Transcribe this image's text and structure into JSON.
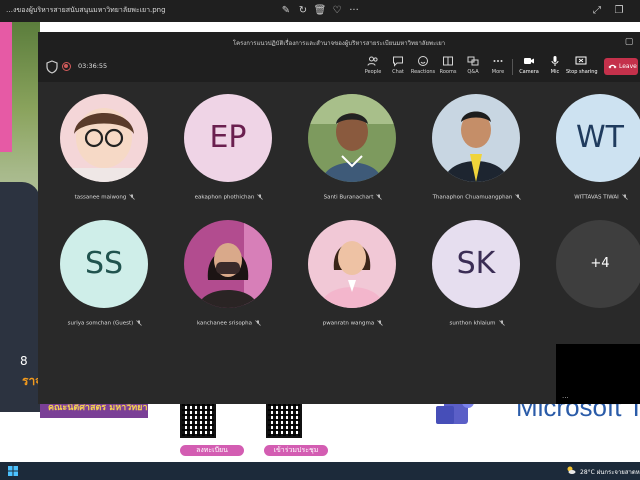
{
  "viewer": {
    "file_title": "…งของผู้บริหารสายสนับสนุนมหาวิทยาลัยพะเยา.png",
    "icons": [
      "edit-icon",
      "rotate-icon",
      "delete-icon",
      "heart-icon",
      "more-icon",
      "expand-icon",
      "window-restore-icon"
    ]
  },
  "slide": {
    "number_text": "8",
    "orange_text": "ราจารย์",
    "faculty_text": "คณะนิติศาสตร มหาวิทยาลัยพะเยา",
    "qr_left_label": "ลงทะเบียน",
    "qr_right_label": "เข้าร่วมประชุม",
    "logo_text": "Microsoft Te"
  },
  "meeting": {
    "window_title": "โครงการแนวปฏิบัติเรื่องการและสำนาจของผู้บริหารสายระเบียนมหาวิทยาลัยพะเยา",
    "timer": "03:36:55",
    "controls": [
      {
        "label": "People",
        "icon": "people-icon"
      },
      {
        "label": "Chat",
        "icon": "chat-icon"
      },
      {
        "label": "Reactions",
        "icon": "reactions-icon"
      },
      {
        "label": "Rooms",
        "icon": "rooms-icon"
      },
      {
        "label": "Q&A",
        "icon": "qa-icon"
      },
      {
        "label": "More",
        "icon": "more-icon"
      },
      {
        "label": "Camera",
        "icon": "camera-icon"
      },
      {
        "label": "Mic",
        "icon": "mic-icon"
      },
      {
        "label": "Stop sharing",
        "icon": "stop-sharing-icon"
      }
    ],
    "leave_label": "Leave",
    "participants": [
      {
        "name": "tassanee maiwong",
        "initials": "",
        "bg": "#f2d0d4"
      },
      {
        "name": "eakaphon phothichan",
        "initials": "EP",
        "bg": "#efd4e6",
        "fg": "#6a1f4f"
      },
      {
        "name": "Santi Buranachart",
        "initials": "",
        "bg": "#6b8a54"
      },
      {
        "name": "Thanaphon Chuamuangphan",
        "initials": "",
        "bg": "#c9d7e2"
      },
      {
        "name": "WITTAVAS TIWAI",
        "initials": "WT",
        "bg": "#cde2f1",
        "fg": "#1f3b5e"
      },
      {
        "name": "suriya somchan (Guest)",
        "initials": "SS",
        "bg": "#cfeee9",
        "fg": "#20534e"
      },
      {
        "name": "kanchanee srisopha",
        "initials": "",
        "bg": "#b24c8f"
      },
      {
        "name": "pwanratn wangma",
        "initials": "",
        "bg": "#e9b2c4"
      },
      {
        "name": "sunthon khlaium",
        "initials": "SK",
        "bg": "#e6deef",
        "fg": "#3b2d55"
      }
    ],
    "overflow_count": "+4",
    "self_view_menu": "..."
  },
  "taskbar": {
    "weather": "28°C ฝนกระจายสาดหน"
  }
}
